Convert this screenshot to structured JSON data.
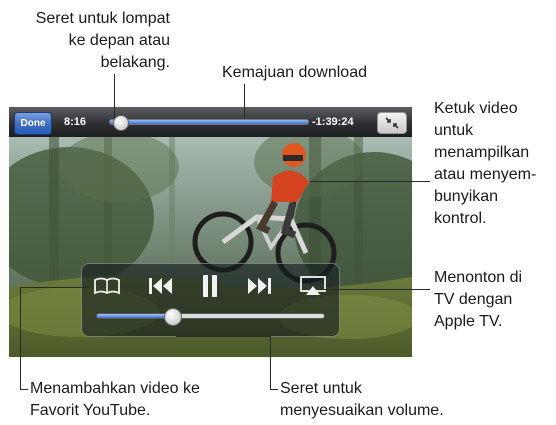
{
  "player": {
    "done_label": "Done",
    "time_elapsed": "8:16",
    "time_remaining": "-1:39:24",
    "playback_progress": 0.05,
    "download_progress": 1.0,
    "volume_level": 0.33,
    "icons": {
      "bookmark": "open-book-icon",
      "previous": "skip-back-icon",
      "pause": "pause-icon",
      "next": "skip-forward-icon",
      "airplay": "airplay-icon",
      "fullscreen": "shrink-icon"
    },
    "colors": {
      "accent": "#3d6fd0",
      "done_button": "#3f6fc6"
    }
  },
  "callouts": {
    "scrub": [
      "Seret untuk lompat",
      "ke depan atau",
      "belakang."
    ],
    "download": [
      "Kemajuan download"
    ],
    "tap_video": [
      "Ketuk video",
      "untuk",
      "menampilkan",
      "atau menyem-",
      "bunyikan",
      "kontrol."
    ],
    "apple_tv": [
      "Menonton di",
      "TV dengan",
      "Apple TV."
    ],
    "favorite": [
      "Menambahkan video ke",
      "Favorit YouTube."
    ],
    "volume": [
      "Seret untuk",
      "menyesuaikan volume."
    ]
  }
}
